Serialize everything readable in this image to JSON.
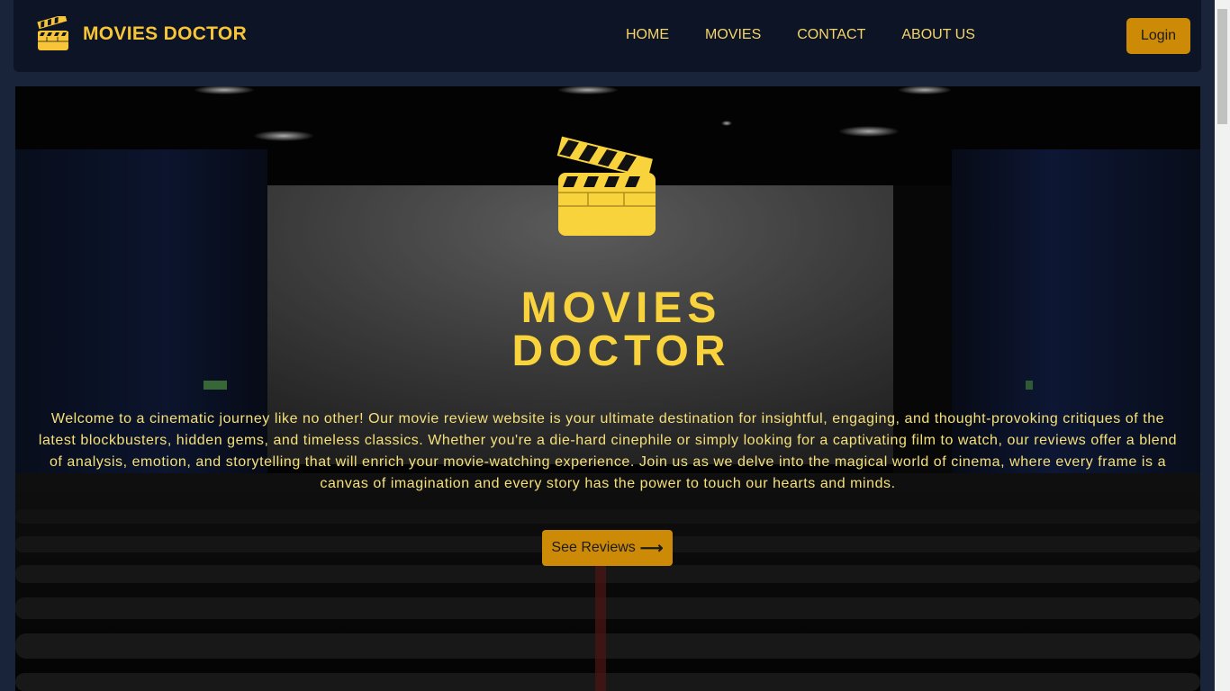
{
  "navbar": {
    "brand": "MOVIES DOCTOR",
    "links": [
      "HOME",
      "MOVIES",
      "CONTACT",
      "ABOUT US"
    ],
    "login_label": "Login"
  },
  "hero": {
    "logo_icon": "clapperboard-icon",
    "title_line1": "MOVIES",
    "title_line2": "DOCTOR",
    "description": "Welcome to a cinematic journey like no other! Our movie review website is your ultimate destination for insightful, engaging, and thought-provoking critiques of the latest blockbusters, hidden gems, and timeless classics. Whether you're a die-hard cinephile or simply looking for a captivating film to watch, our reviews offer a blend of analysis, emotion, and storytelling that will enrich your movie-watching experience. Join us as we delve into the magical world of cinema, where every frame is a canvas of imagination and every story has the power to touch our hearts and minds.",
    "cta_label": "See Reviews",
    "cta_icon": "arrow-right-icon"
  },
  "colors": {
    "accent": "#f8d33c",
    "button": "#cc8a07",
    "nav_bg": "#0d1426",
    "page_bg": "#19233a"
  }
}
